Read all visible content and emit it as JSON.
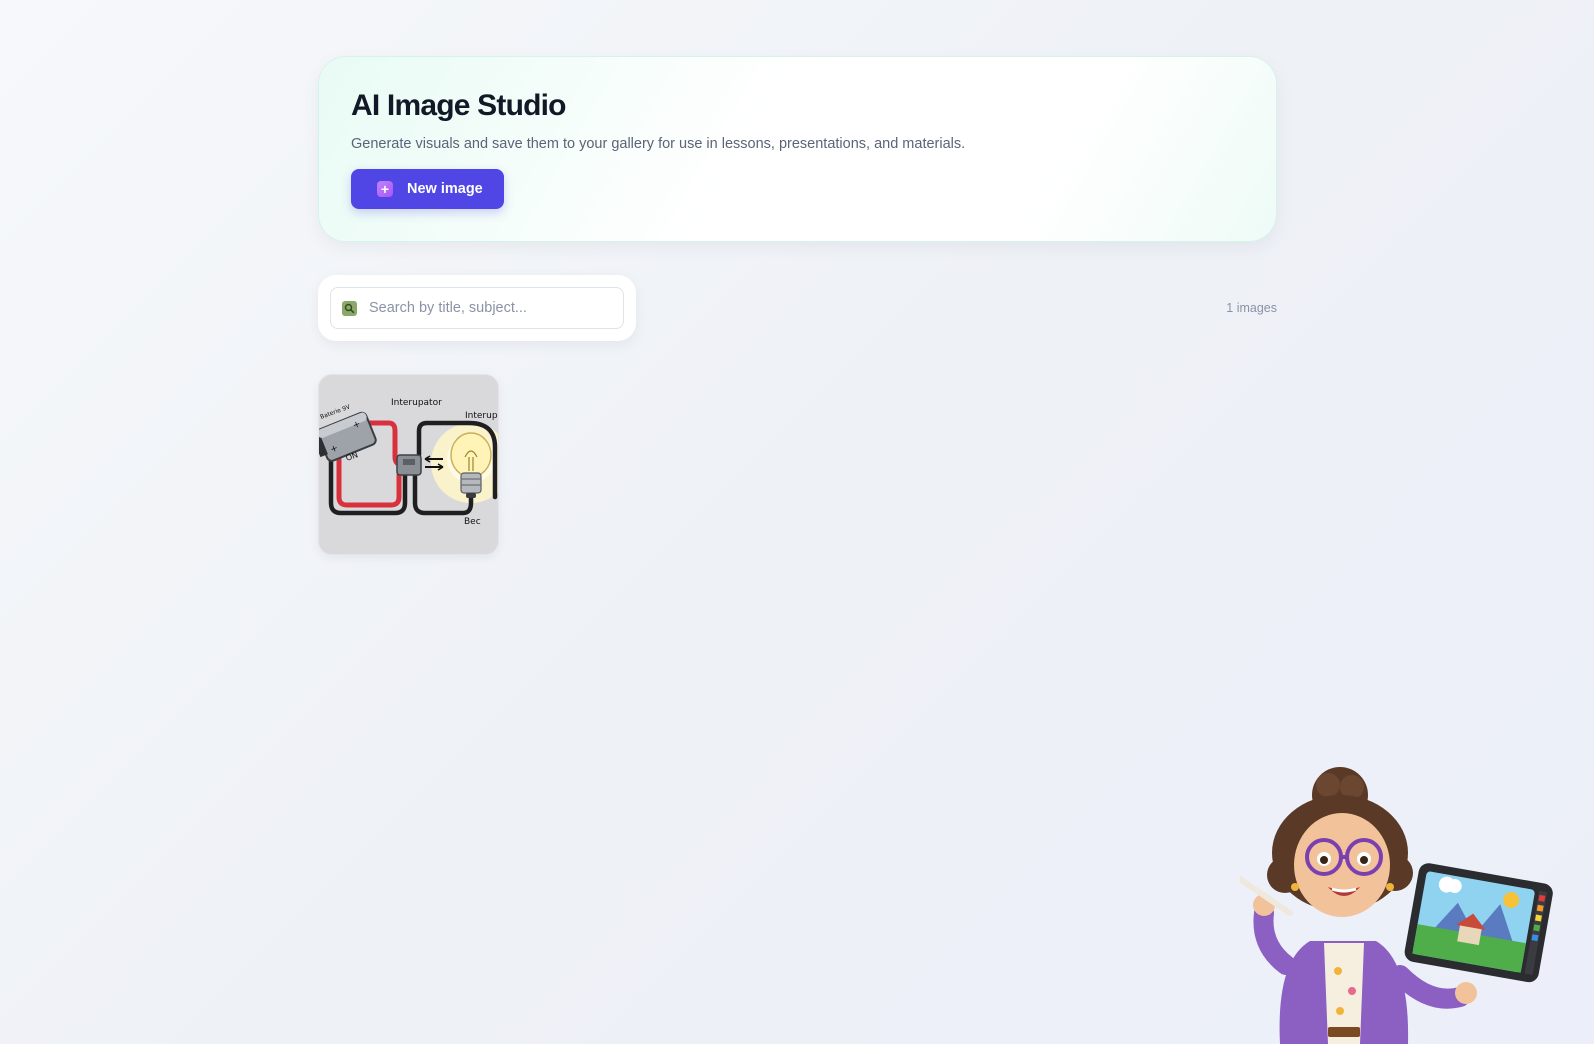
{
  "header": {
    "title": "AI Image Studio",
    "subtitle": "Generate visuals and save them to your gallery for use in lessons, presentations, and materials.",
    "new_button_label": "New image"
  },
  "search": {
    "placeholder": "Search by title, subject...",
    "value": ""
  },
  "gallery": {
    "count_label": "1 images",
    "items": [
      {
        "icon": "circuit-diagram-image",
        "labels": [
          "Interupator",
          "Interupo",
          "Baterie 9V",
          "ON",
          "Bec"
        ]
      }
    ]
  },
  "colors": {
    "accent": "#4f46e5",
    "title": "#111827",
    "muted": "#5b6478"
  }
}
